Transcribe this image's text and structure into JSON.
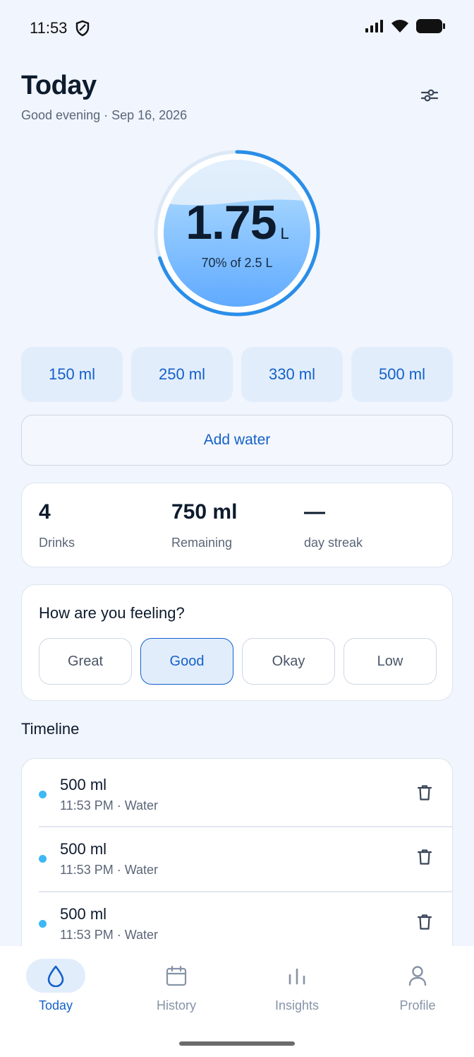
{
  "status_bar": {
    "time": "11:53"
  },
  "header": {
    "title": "Today",
    "subtitle": "Good evening · Sep 16, 2026"
  },
  "progress": {
    "value": "1.75",
    "unit": "L",
    "percent_text": "70% of 2.5 L",
    "fraction": 0.7
  },
  "quick_add": [
    "150 ml",
    "250 ml",
    "330 ml",
    "500 ml"
  ],
  "add_water_label": "Add water",
  "stats": [
    {
      "value": "4",
      "label": "Drinks"
    },
    {
      "value": "750 ml",
      "label": "Remaining"
    },
    {
      "value": "—",
      "label": "day streak"
    }
  ],
  "mood": {
    "title": "How are you feeling?",
    "options": [
      "Great",
      "Good",
      "Okay",
      "Low"
    ],
    "selected": "Good"
  },
  "timeline": {
    "title": "Timeline",
    "items": [
      {
        "amount": "500 ml",
        "meta": "11:53 PM · Water"
      },
      {
        "amount": "500 ml",
        "meta": "11:53 PM · Water"
      },
      {
        "amount": "500 ml",
        "meta": "11:53 PM · Water"
      }
    ]
  },
  "nav": [
    {
      "label": "Today",
      "icon": "drop-icon",
      "active": true
    },
    {
      "label": "History",
      "icon": "calendar-icon",
      "active": false
    },
    {
      "label": "Insights",
      "icon": "bar-chart-icon",
      "active": false
    },
    {
      "label": "Profile",
      "icon": "person-icon",
      "active": false
    }
  ],
  "colors": {
    "accent": "#1461c9",
    "ring": "#2a8ee8",
    "background": "#f1f5fd",
    "dot": "#3db8f5"
  }
}
